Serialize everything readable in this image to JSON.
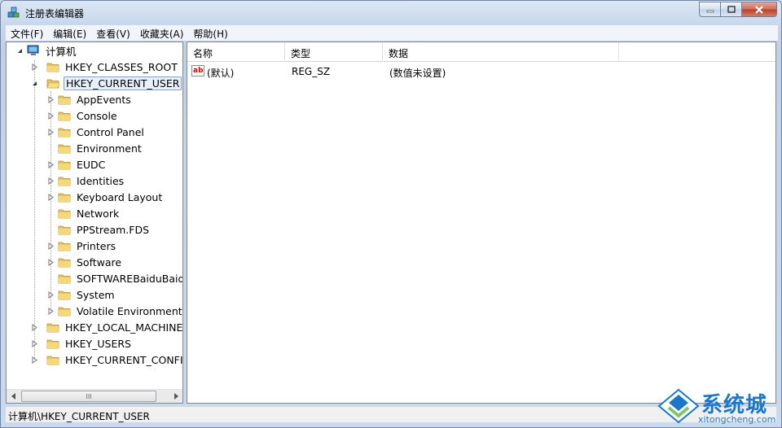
{
  "window": {
    "title": "注册表编辑器",
    "icons": {
      "app": "registry-cubes-icon",
      "minimize": "minimize-icon",
      "maximize": "maximize-icon",
      "close": "close-icon"
    }
  },
  "menu": [
    "文件(F)",
    "编辑(E)",
    "查看(V)",
    "收藏夹(A)",
    "帮助(H)"
  ],
  "tree": {
    "root": "计算机",
    "hives_top": [
      "HKEY_CLASSES_ROOT",
      "HKEY_CURRENT_USER"
    ],
    "current_user_children": [
      "AppEvents",
      "Console",
      "Control Panel",
      "Environment",
      "EUDC",
      "Identities",
      "Keyboard Layout",
      "Network",
      "PPStream.FDS",
      "Printers",
      "Software",
      "SOFTWAREBaiduBaidu",
      "System",
      "Volatile Environment"
    ],
    "hives_bottom": [
      "HKEY_LOCAL_MACHINE",
      "HKEY_USERS",
      "HKEY_CURRENT_CONFIG"
    ],
    "selected": "HKEY_CURRENT_USER",
    "scrollbar_thumb_glyph": "III"
  },
  "list": {
    "columns": [
      "名称",
      "类型",
      "数据"
    ],
    "rows": [
      {
        "name": "(默认)",
        "type": "REG_SZ",
        "data": "(数值未设置)",
        "icon": "string-value-ab-icon"
      }
    ]
  },
  "statusbar": {
    "path": "计算机\\HKEY_CURRENT_USER"
  },
  "watermark": {
    "cn": "系统城",
    "en": "xitongcheng.com"
  },
  "colors": {
    "folder": "#e8c45a",
    "selection_border": "#7da2ce",
    "watermark": "#1b78c9"
  }
}
